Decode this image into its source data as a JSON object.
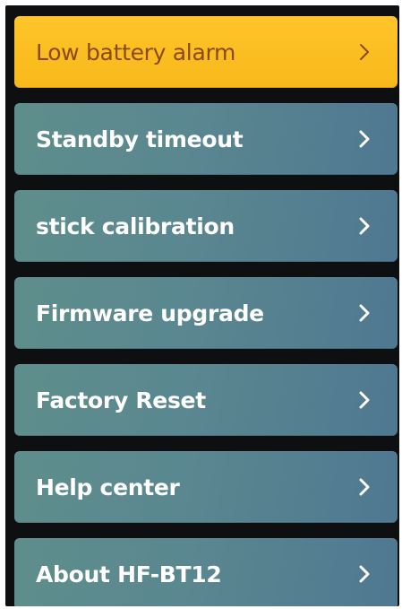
{
  "menu": {
    "items": [
      {
        "label": "Low battery alarm",
        "selected": true
      },
      {
        "label": "Standby timeout",
        "selected": false
      },
      {
        "label": "stick calibration",
        "selected": false
      },
      {
        "label": "Firmware upgrade",
        "selected": false
      },
      {
        "label": "Factory Reset",
        "selected": false
      },
      {
        "label": "Help center",
        "selected": false
      },
      {
        "label": "About HF-BT12",
        "selected": false
      }
    ],
    "chevron_icon": "chevron-right-icon"
  },
  "colors": {
    "selected_bg": "#ffc52a",
    "selected_text": "#8a4a12",
    "item_bg": "#5a8790",
    "item_text": "#ffffff",
    "screen_bg": "#0d0f10"
  }
}
